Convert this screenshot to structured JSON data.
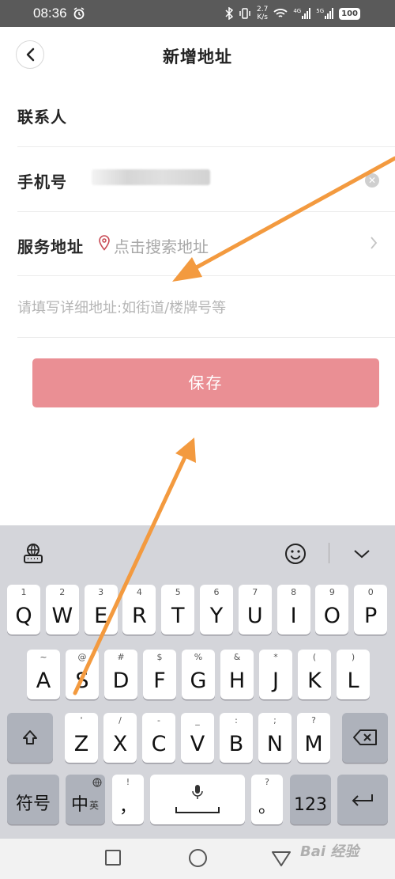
{
  "status_bar": {
    "time": "08:36",
    "net_speed_value": "2.7",
    "net_speed_unit": "K/s",
    "signal_1_label": "4G",
    "signal_2_label": "5G",
    "battery": "100"
  },
  "header": {
    "title": "新增地址"
  },
  "form": {
    "contact_label": "联系人",
    "phone_label": "手机号",
    "address_label": "服务地址",
    "address_placeholder": "点击搜索地址",
    "detail_placeholder": "请填写详细地址:如街道/楼牌号等"
  },
  "save_button": {
    "label": "保存",
    "color": "#ea8f94"
  },
  "keyboard": {
    "row1": [
      {
        "main": "Q",
        "sub": "1"
      },
      {
        "main": "W",
        "sub": "2"
      },
      {
        "main": "E",
        "sub": "3"
      },
      {
        "main": "R",
        "sub": "4"
      },
      {
        "main": "T",
        "sub": "5"
      },
      {
        "main": "Y",
        "sub": "6"
      },
      {
        "main": "U",
        "sub": "7"
      },
      {
        "main": "I",
        "sub": "8"
      },
      {
        "main": "O",
        "sub": "9"
      },
      {
        "main": "P",
        "sub": "0"
      }
    ],
    "row2": [
      {
        "main": "A",
        "sub": "~"
      },
      {
        "main": "S",
        "sub": "@"
      },
      {
        "main": "D",
        "sub": "#"
      },
      {
        "main": "F",
        "sub": "$"
      },
      {
        "main": "G",
        "sub": "%"
      },
      {
        "main": "H",
        "sub": "&"
      },
      {
        "main": "J",
        "sub": "*"
      },
      {
        "main": "K",
        "sub": "("
      },
      {
        "main": "L",
        "sub": ")"
      }
    ],
    "row3": [
      {
        "main": "Z",
        "sub": "'"
      },
      {
        "main": "X",
        "sub": "/"
      },
      {
        "main": "C",
        "sub": "-"
      },
      {
        "main": "V",
        "sub": "_"
      },
      {
        "main": "B",
        "sub": ":"
      },
      {
        "main": "N",
        "sub": ";"
      },
      {
        "main": "M",
        "sub": "?"
      }
    ],
    "symbols_key": "符号",
    "lang_key_main": "中",
    "lang_key_sub": "英",
    "comma_key": "，",
    "comma_sub": "!",
    "period_key": "。",
    "period_sub": "?",
    "num_key": "123"
  },
  "watermark": "Bai 经验",
  "colors": {
    "accent_arrow": "#f39a3f",
    "keyboard_bg": "#d4d5da"
  }
}
